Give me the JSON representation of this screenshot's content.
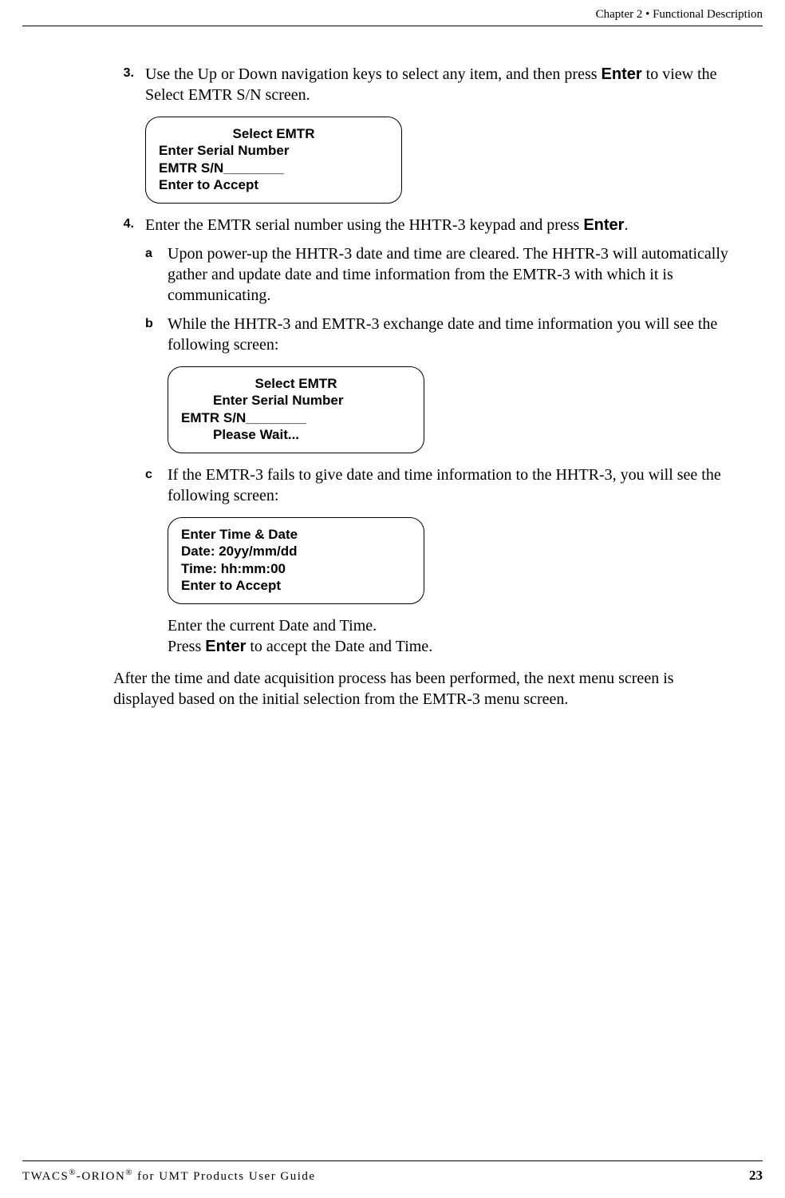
{
  "header": {
    "chapter": "Chapter 2 • Functional Description"
  },
  "steps": {
    "s3": {
      "marker": "3.",
      "text_before": "Use the Up or Down navigation keys to select any item, and then press ",
      "enter": "Enter",
      "text_after": " to view the Select EMTR S/N screen."
    },
    "screen1": {
      "l1": "Select EMTR",
      "l2": "Enter Serial Number",
      "l3": "EMTR S/N________",
      "l4": "Enter to Accept"
    },
    "s4": {
      "marker": "4.",
      "text_before": "Enter the EMTR serial number using the HHTR-3 keypad and press ",
      "enter": "Enter",
      "period": "."
    },
    "s4a": {
      "marker": "a",
      "text": "Upon power-up the HHTR-3 date and time are cleared. The HHTR-3 will automatically gather and update date and time information from the EMTR-3 with which it is communicating."
    },
    "s4b": {
      "marker": "b",
      "text": "While the HHTR-3 and EMTR-3 exchange date and time information you will see the following screen:"
    },
    "screen2": {
      "l1": "Select EMTR",
      "l2": "Enter Serial Number",
      "l3": "EMTR S/N________",
      "l4": "Please Wait..."
    },
    "s4c": {
      "marker": "c",
      "text": "If the EMTR-3 fails to give date and time information to the HHTR-3, you will see the following screen:"
    },
    "screen3": {
      "l1": "Enter Time & Date",
      "l2": "Date:  20yy/mm/dd",
      "l3": "Time:  hh:mm:00",
      "l4": "Enter to Accept"
    },
    "s4c_p1": "Enter the current Date and Time.",
    "s4c_p2_before": "Press ",
    "s4c_p2_enter": "Enter",
    "s4c_p2_after": " to accept the Date and Time.",
    "final": "After the time and date acquisition process has been performed, the next menu screen is displayed based on the initial selection from the EMTR-3 menu screen."
  },
  "footer": {
    "product_a": "TWACS",
    "reg": "®",
    "dash": "-ORION",
    "tail": " for UMT Products User Guide",
    "page": "23"
  }
}
